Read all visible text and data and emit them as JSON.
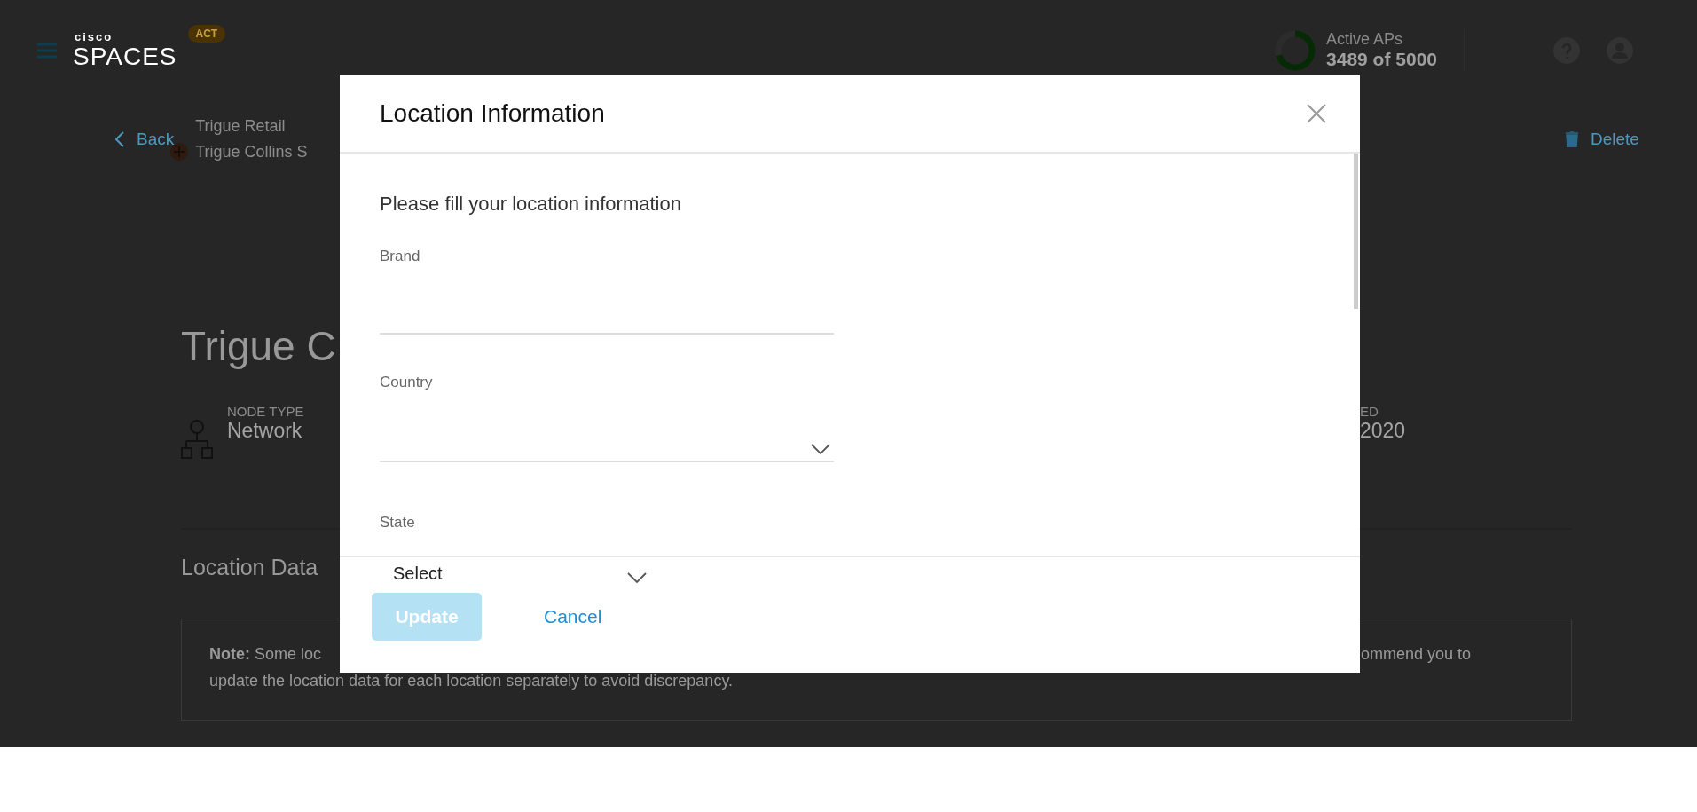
{
  "header": {
    "logo_top": "cisco",
    "logo": "SPACES",
    "badge": "ACT",
    "active_aps": {
      "label": "Active APs",
      "value": "3489 of 5000",
      "level": 0.7
    }
  },
  "breadcrumb": {
    "back": "Back",
    "parent": "Trigue Retail",
    "current": "Trigue Collins S"
  },
  "delete": "Delete",
  "location": {
    "title": "Trigue C",
    "fields": [
      {
        "label": "NODE TYPE",
        "value": "Network"
      },
      {
        "label": "ED",
        "value": "2020"
      }
    ]
  },
  "section_title": "Location Data",
  "note": {
    "line1_left": "**Note:** Some loc",
    "line1_right": "ommend you to",
    "line2": "update the location data for each location separately to avoid discrepancy."
  },
  "modal": {
    "title": "Location Information",
    "intro": "Please fill your location information",
    "fields": [
      {
        "kind": "text",
        "label": "Brand"
      },
      {
        "kind": "select",
        "label": "Country"
      },
      {
        "kind": "select",
        "label": "State",
        "value": "Select"
      }
    ],
    "buttons": [
      {
        "kind": "primary",
        "label": "Update",
        "disabled": true
      },
      {
        "kind": "link",
        "label": "Cancel",
        "disabled": false
      }
    ]
  }
}
